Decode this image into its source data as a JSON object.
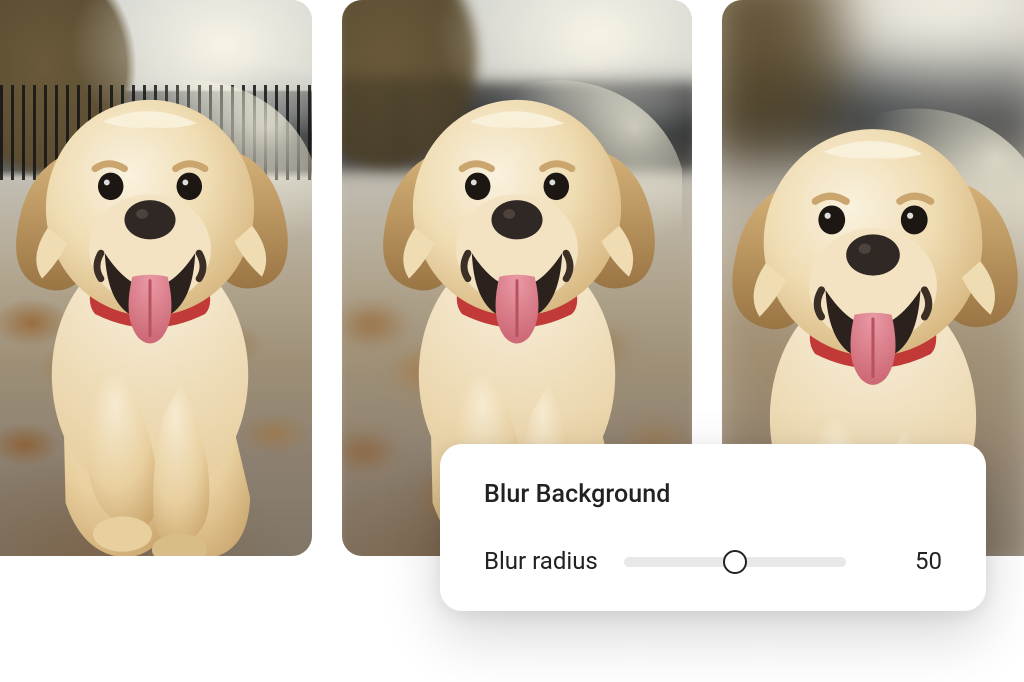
{
  "gallery": {
    "subject": "golden-retriever-dog",
    "tiles": [
      {
        "blur_level": 0,
        "description": "original"
      },
      {
        "blur_level": 1,
        "description": "slight background blur"
      },
      {
        "blur_level": 2,
        "description": "heavy background blur"
      }
    ]
  },
  "panel": {
    "title": "Blur Background",
    "slider": {
      "label": "Blur radius",
      "value": "50",
      "percent": 50,
      "min": 0,
      "max": 100
    }
  },
  "palette": {
    "fur_light": "#f4e6c6",
    "fur_mid": "#e8cf9e",
    "fur_dark": "#c9a76f",
    "ear_dark": "#a07a48",
    "nose": "#3b332e",
    "tongue": "#d87d8a",
    "collar": "#c23a38",
    "leaf": "#9a6a3c"
  }
}
